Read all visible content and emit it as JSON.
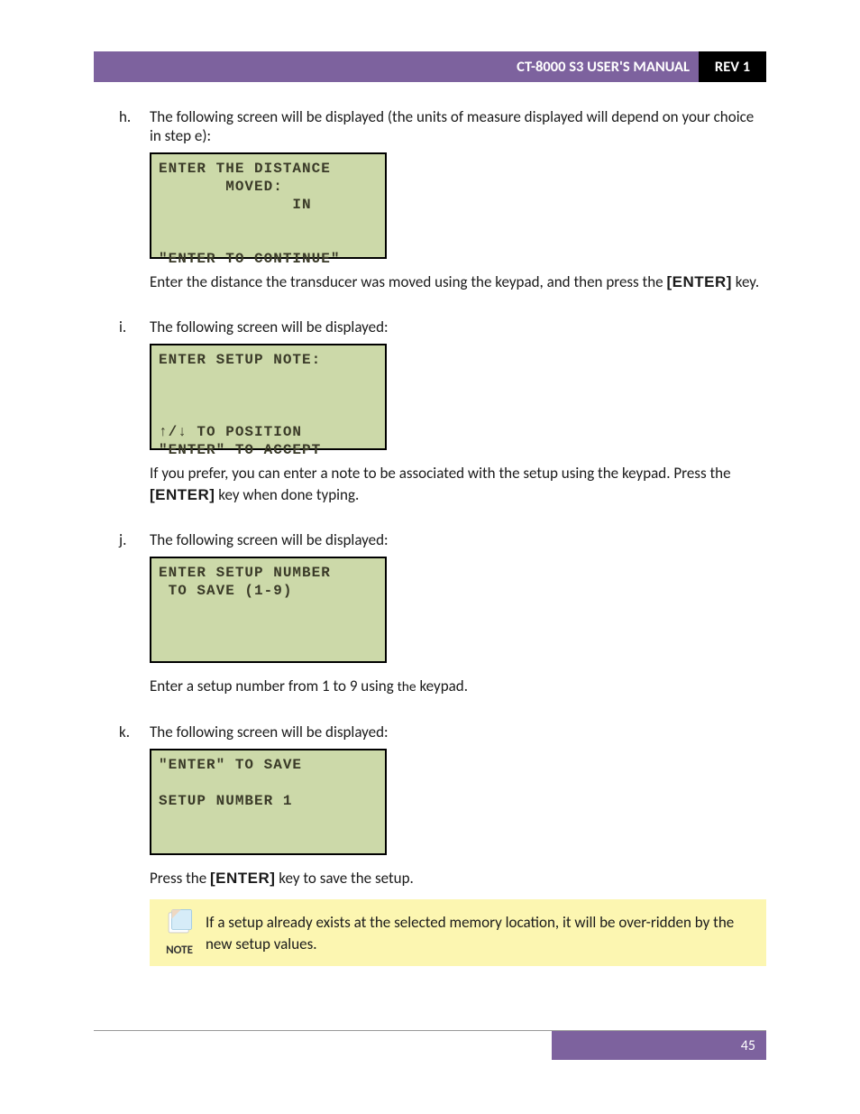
{
  "header": {
    "title": "CT-8000 S3 USER'S MANUAL",
    "rev": "REV 1"
  },
  "items": {
    "h": {
      "marker": "h.",
      "intro": "The following screen will be displayed (the units of measure displayed will depend on your choice in step e):",
      "lcd": "ENTER THE DISTANCE\n       MOVED:\n              IN\n\n\n\"ENTER TO CONTINUE\"",
      "after_a": "Enter the distance the transducer was moved using the keypad, and then press the ",
      "key": "[ENTER]",
      "after_b": " key."
    },
    "i": {
      "marker": "i.",
      "intro": "The following screen will be displayed:",
      "lcd": "ENTER SETUP NOTE:\n\n\n\n↑/↓ TO POSITION\n\"ENTER\" TO ACCEPT",
      "after_a": "If you prefer, you can enter a note to be associated with the setup using the keypad. Press the ",
      "key": "[ENTER]",
      "after_b": " key when done typing."
    },
    "j": {
      "marker": "j.",
      "intro": "The following screen will be displayed:",
      "lcd": "ENTER SETUP NUMBER\n TO SAVE (1-9)\n\n\n\n",
      "after_a": "Enter a setup number from 1 to 9 using ",
      "the": "the",
      "after_b": " keypad."
    },
    "k": {
      "marker": "k.",
      "intro": "The following screen will be displayed:",
      "lcd": "\"ENTER\" TO SAVE\n\nSETUP NUMBER 1\n\n\n",
      "after_a": "Press the ",
      "key": "[ENTER]",
      "after_b": " key to save the setup.",
      "note_label": "NOTE",
      "note_text": "If a setup already exists at the selected memory location, it will be over-ridden by the new setup values."
    }
  },
  "footer": {
    "page": "45"
  }
}
